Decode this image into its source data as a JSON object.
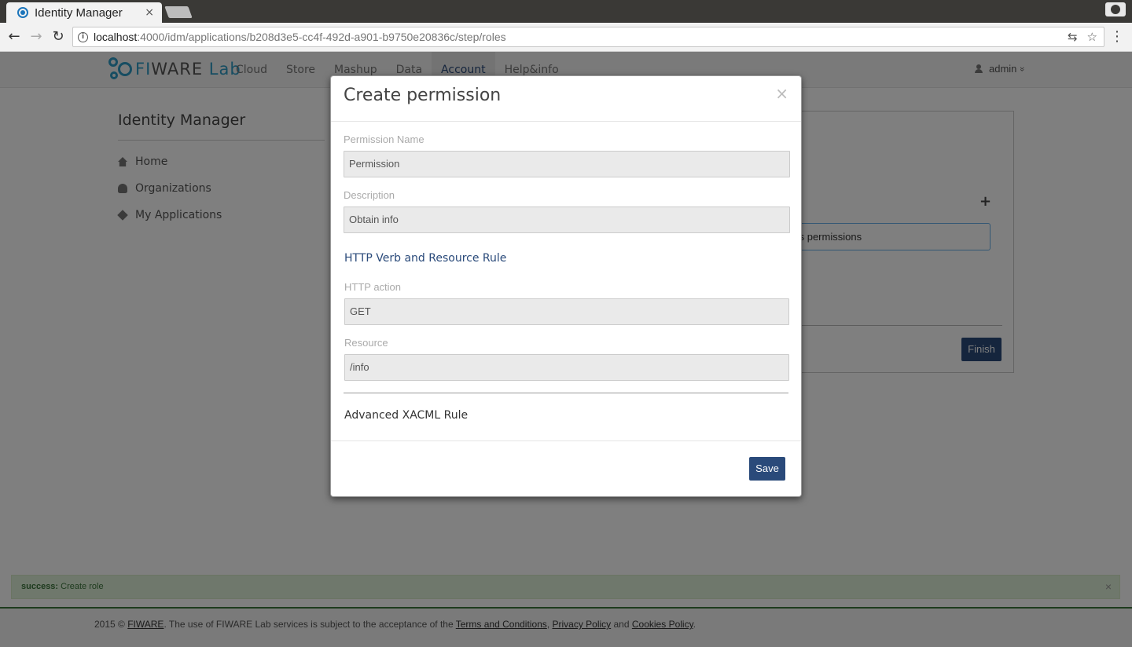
{
  "browser": {
    "tab_title": "Identity Manager",
    "tab_close": "×",
    "url_host": "localhost",
    "url_path": ":4000/idm/applications/b208d3e5-cc4f-492d-a901-b9750e20836c/step/roles",
    "back": "←",
    "forward": "→",
    "reload": "↻",
    "info": "i",
    "translate": "⇆",
    "bookmark": "☆",
    "menu": "⋮"
  },
  "navbar": {
    "logo_fi": "FI",
    "logo_ware": "WARE",
    "logo_lab": " Lab",
    "items": [
      "Cloud",
      "Store",
      "Mashup",
      "Data",
      "Account",
      "Help&info"
    ],
    "active": "Account",
    "user": "admin",
    "user_caret": "»"
  },
  "sidebar": {
    "title": "Identity Manager",
    "items": [
      {
        "label": "Home",
        "icon": "home-icon"
      },
      {
        "label": "Organizations",
        "icon": "users-icon"
      },
      {
        "label": "My Applications",
        "icon": "cube-icon"
      }
    ]
  },
  "panel": {
    "plus": "+",
    "field_text": "ts permissions",
    "finish_label": "Finish"
  },
  "alert": {
    "prefix": "success:",
    "message": " Create role",
    "close": "×"
  },
  "footer": {
    "lead": "2015 © ",
    "fiware_link": "FIWARE",
    "middle": ". The use of FIWARE Lab services is subject to the acceptance of the ",
    "terms_link": "Terms and Conditions",
    "comma": ", ",
    "privacy_link": "Privacy Policy",
    "and": " and ",
    "cookies_link": "Cookies Policy",
    "end": "."
  },
  "modal": {
    "title": "Create permission",
    "close": "×",
    "permission_name_label": "Permission Name",
    "permission_name_value": "Permission",
    "description_label": "Description",
    "description_value": "Obtain info",
    "http_section_title": "HTTP Verb and Resource Rule",
    "http_action_label": "HTTP action",
    "http_action_value": "GET",
    "resource_label": "Resource",
    "resource_value": "/info",
    "advanced_title": "Advanced XACML Rule",
    "save_label": "Save"
  },
  "colors": {
    "brand": "#2f9bc4",
    "primary_button": "#2a4a7a",
    "success_bg": "#dff0d8"
  }
}
